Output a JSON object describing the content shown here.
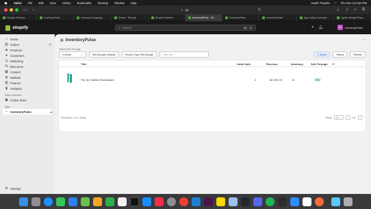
{
  "menubar": {
    "items": [
      "Safari",
      "File",
      "Edit",
      "View",
      "History",
      "Bookmarks",
      "Develop",
      "Window",
      "Help"
    ],
    "user": "Heath Peeples",
    "datetime": "Thu Nov 13 6:53 PM"
  },
  "browser": {
    "address": "aq",
    "tabs": [
      {
        "label": "Shopify Partners"
      },
      {
        "label": "InventoryPulse"
      },
      {
        "label": "Inventory Shopping"
      },
      {
        "label": "Orders · Shopify"
      },
      {
        "label": "Shopify Partners"
      },
      {
        "label": "InventoryPulse · Sh...",
        "active": true
      },
      {
        "label": "InventoryPulse"
      },
      {
        "label": "InventoryPulse"
      },
      {
        "label": "App Listing Submissi..."
      },
      {
        "label": "Lighter Weight Shop..."
      }
    ]
  },
  "shopify": {
    "logo": "shopify",
    "search_placeholder": "Search",
    "search_keys": [
      "⌘",
      "K"
    ],
    "store_initials": "IH",
    "store_name": "InventoryPulse"
  },
  "sidebar": {
    "items": [
      {
        "label": "Home",
        "icon": "home-icon"
      },
      {
        "label": "Orders",
        "icon": "orders-icon",
        "badge": "1"
      },
      {
        "label": "Products",
        "icon": "tag-icon"
      },
      {
        "label": "Customers",
        "icon": "person-icon"
      },
      {
        "label": "Marketing",
        "icon": "target-icon"
      },
      {
        "label": "Discounts",
        "icon": "discount-icon"
      },
      {
        "label": "Content",
        "icon": "content-icon"
      },
      {
        "label": "Markets",
        "icon": "globe-icon"
      },
      {
        "label": "Finance",
        "icon": "bank-icon"
      },
      {
        "label": "Analytics",
        "icon": "chart-icon"
      }
    ],
    "sales_channels_label": "Sales channels",
    "online_store": "Online Store",
    "apps_label": "Apps",
    "app_item": "InventoryPulse",
    "settings": "Settings"
  },
  "page": {
    "title": "InventoryPulse",
    "filter_label": "Select Sell-Through",
    "period": "6 weeks",
    "sell_through_defaults": "Sell-through Defaults",
    "product_type": "Product Type Sell-through",
    "filter_placeholder": "Filter title...",
    "export": "Export",
    "history": "History",
    "refresh": "Refresh"
  },
  "table": {
    "headers": {
      "title": "Title",
      "units": "Units Sold",
      "revenue": "Revenue",
      "inventory": "Inventory",
      "sell_through": "Sell-Through"
    },
    "rows": [
      {
        "title": "The 3p Fulfilled Snowboard",
        "units": "2",
        "revenue": "$2,259.90",
        "inventory": "19",
        "sell_through": "9%"
      }
    ],
    "footer": {
      "info": "Showing 1-1 of 1 items",
      "rows_label": "Rows",
      "rows_value": "10",
      "page": "1/1"
    }
  },
  "colors": {
    "accent": "#95bf47",
    "badge_green": "#cdeccc",
    "sidebar_bg": "#ebebeb",
    "main_bg": "#f1f1f1"
  }
}
